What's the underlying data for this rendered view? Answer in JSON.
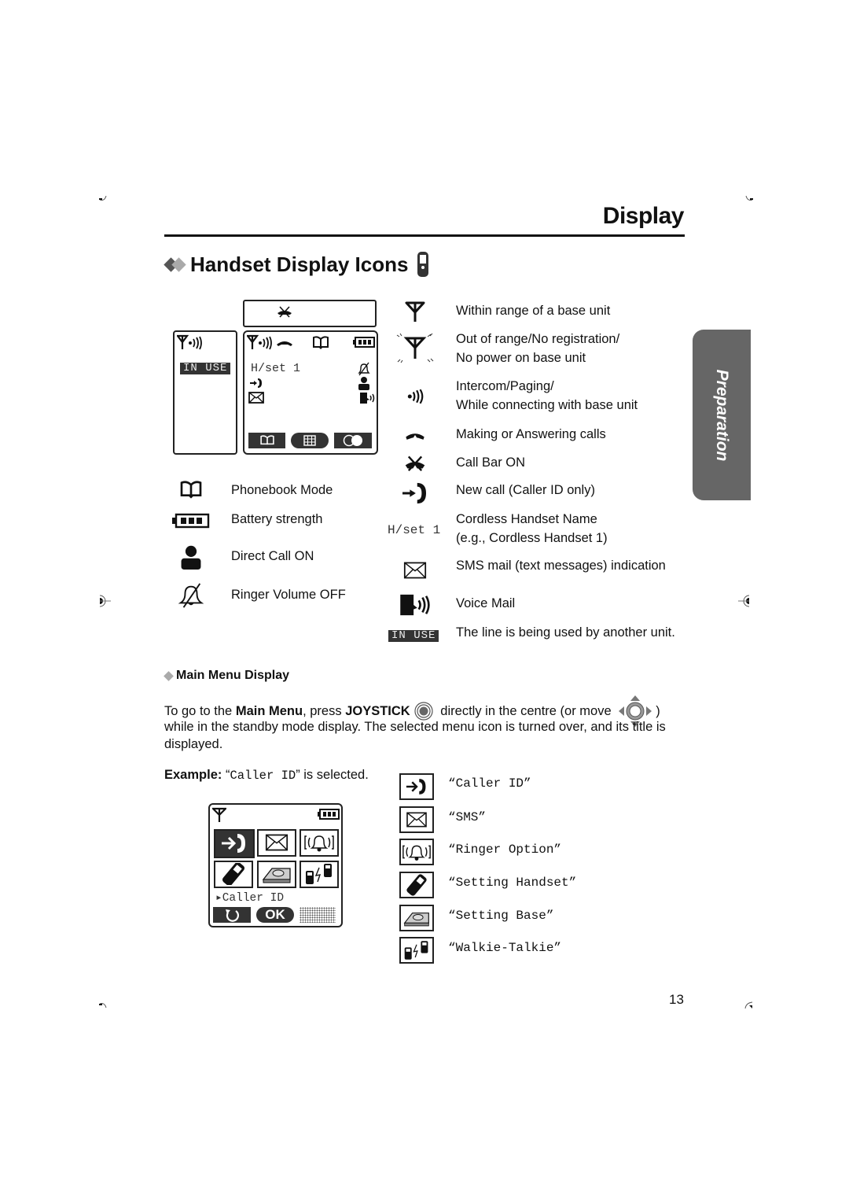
{
  "page": {
    "heading": "Display",
    "section_title": "Handset Display Icons",
    "side_tab": "Preparation",
    "page_number": "13"
  },
  "lcd_demo": {
    "left_screen_status": "IN USE",
    "handset_name": "H/set 1"
  },
  "left_icon_list": [
    {
      "icon": "phonebook-icon",
      "label": "Phonebook Mode"
    },
    {
      "icon": "battery-icon",
      "label": "Battery strength"
    },
    {
      "icon": "direct-call-icon",
      "label": "Direct Call ON"
    },
    {
      "icon": "ringer-off-icon",
      "label": "Ringer Volume OFF"
    }
  ],
  "right_icon_list": [
    {
      "icon": "antenna-icon",
      "label_lines": [
        "Within range of a base unit"
      ]
    },
    {
      "icon": "antenna-flashing-icon",
      "label_lines": [
        "Out of range/No registration/",
        "No power on base unit"
      ]
    },
    {
      "icon": "intercom-icon",
      "label_lines": [
        "Intercom/Paging/",
        "While connecting with base unit"
      ]
    },
    {
      "icon": "handset-off-hook-icon",
      "label_lines": [
        "Making or Answering calls"
      ]
    },
    {
      "icon": "call-bar-icon",
      "label_lines": [
        "Call Bar ON"
      ]
    },
    {
      "icon": "new-call-icon",
      "label_lines": [
        "New call (Caller ID only)"
      ]
    },
    {
      "icon_text": "H/set 1",
      "label_lines": [
        "Cordless Handset Name",
        "(e.g., Cordless Handset 1)"
      ]
    },
    {
      "icon": "sms-envelope-icon",
      "label_lines": [
        "SMS mail (text messages) indication"
      ]
    },
    {
      "icon": "voice-mail-icon",
      "label_lines": [
        "Voice Mail"
      ]
    },
    {
      "icon_text": "IN USE",
      "label_lines": [
        "The line is being used by another unit."
      ]
    }
  ],
  "main_menu": {
    "title": "Main Menu Display",
    "intro_p1": "To go to the ",
    "intro_b1": "Main Menu",
    "intro_p2": ", press ",
    "intro_b2": "JOYSTICK",
    "intro_p3": " directly in the centre (or move ",
    "intro_p4": ")",
    "intro_line2": "while in the standby mode display. The selected menu icon is turned over, and its title is",
    "intro_line3": "displayed.",
    "example_bold": "Example:",
    "example_q1": " “",
    "example_mono": "Caller ID",
    "example_rest": "” is selected.",
    "screen_selected": "Caller ID",
    "ok_label": "OK",
    "items": [
      {
        "icon": "caller-id-icon",
        "label": "“Caller ID”"
      },
      {
        "icon": "sms-icon",
        "label": "“SMS”"
      },
      {
        "icon": "ringer-option-icon",
        "label": "“Ringer Option”"
      },
      {
        "icon": "setting-handset-icon",
        "label": "“Setting Handset”"
      },
      {
        "icon": "setting-base-icon",
        "label": "“Setting Base”"
      },
      {
        "icon": "walkie-talkie-icon",
        "label": "“Walkie-Talkie”"
      }
    ]
  },
  "colors": {
    "tab_gray": "#666666",
    "diamond_dark": "#555555",
    "diamond_light": "#aaaaaa",
    "inuse_bg": "#333333"
  }
}
